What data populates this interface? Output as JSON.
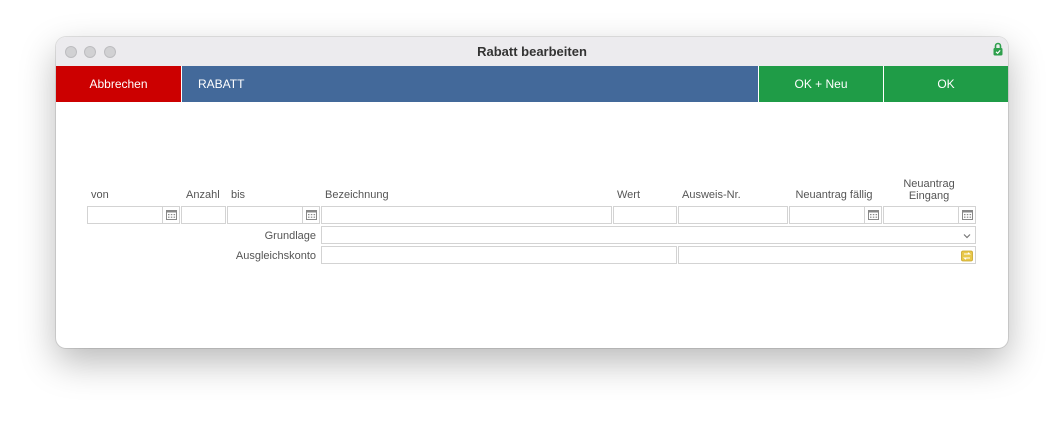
{
  "window": {
    "title": "Rabatt bearbeiten"
  },
  "toolbar": {
    "cancel_label": "Abbrechen",
    "section_label": "RABATT",
    "ok_new_label": "OK + Neu",
    "ok_label": "OK"
  },
  "columns": {
    "von": "von",
    "anzahl": "Anzahl",
    "bis": "bis",
    "bezeichnung": "Bezeichnung",
    "wert": "Wert",
    "ausweis_nr": "Ausweis-Nr.",
    "neuantrag_faellig": "Neuantrag fällig",
    "neuantrag_eingang_line1": "Neuantrag",
    "neuantrag_eingang_line2": "Eingang"
  },
  "fields": {
    "von": "",
    "anzahl": "",
    "bis": "",
    "bezeichnung": "",
    "wert": "",
    "ausweis_nr": "",
    "neuantrag_faellig": "",
    "neuantrag_eingang": ""
  },
  "rows": {
    "grundlage_label": "Grundlage",
    "grundlage_value": "",
    "ausgleichskonto_label": "Ausgleichskonto",
    "ausgleichskonto_value": "",
    "ausgleichskonto_name": ""
  },
  "colors": {
    "cancel": "#cc0000",
    "section": "#43699a",
    "confirm": "#1f9c47",
    "lock_icon": "#2e9f4c"
  },
  "icons": [
    "lock-icon",
    "calendar-icon",
    "chevron-down-icon",
    "lookup-icon"
  ]
}
